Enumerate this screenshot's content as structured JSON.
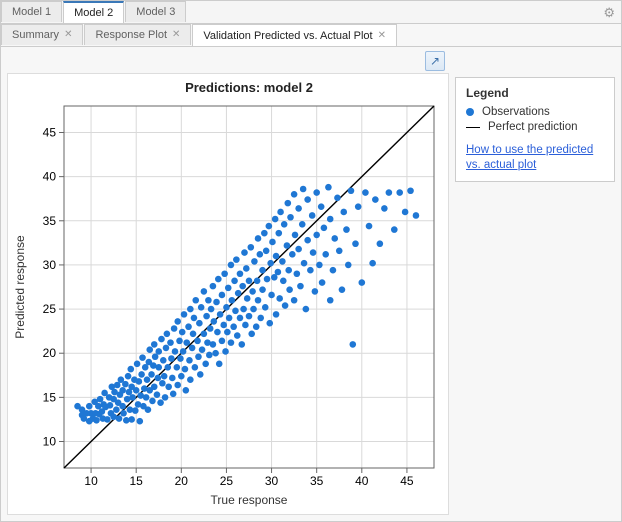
{
  "top_tabs": [
    {
      "label": "Model 1",
      "selected": false
    },
    {
      "label": "Model 2",
      "selected": true
    },
    {
      "label": "Model 3",
      "selected": false
    }
  ],
  "inner_tabs": [
    {
      "label": "Summary",
      "closable": true,
      "selected": false
    },
    {
      "label": "Response Plot",
      "closable": true,
      "selected": false
    },
    {
      "label": "Validation Predicted vs. Actual Plot",
      "closable": true,
      "selected": true
    }
  ],
  "legend": {
    "title": "Legend",
    "observations": "Observations",
    "perfect": "Perfect prediction",
    "help_link": "How to use the predicted vs. actual plot"
  },
  "chart_data": {
    "type": "scatter",
    "title": "Predictions: model 2",
    "xlabel": "True response",
    "ylabel": "Predicted response",
    "xlim": [
      7,
      48
    ],
    "ylim": [
      7,
      48
    ],
    "xticks": [
      10,
      15,
      20,
      25,
      30,
      35,
      40,
      45
    ],
    "yticks": [
      10,
      15,
      20,
      25,
      30,
      35,
      40,
      45
    ],
    "reference_line": {
      "from": [
        7,
        7
      ],
      "to": [
        48,
        48
      ]
    },
    "series": [
      {
        "name": "Observations",
        "marker": "circle",
        "color": "#1f77d4",
        "points": [
          [
            8.5,
            14.0
          ],
          [
            9.0,
            13.0
          ],
          [
            9.0,
            13.6
          ],
          [
            9.2,
            12.6
          ],
          [
            9.5,
            13.2
          ],
          [
            9.8,
            14.0
          ],
          [
            9.8,
            12.3
          ],
          [
            10.0,
            13.2
          ],
          [
            10.2,
            12.6
          ],
          [
            10.4,
            14.5
          ],
          [
            10.5,
            13.2
          ],
          [
            10.6,
            12.4
          ],
          [
            10.8,
            14.0
          ],
          [
            10.9,
            13.1
          ],
          [
            11.0,
            14.8
          ],
          [
            11.2,
            13.4
          ],
          [
            11.3,
            12.6
          ],
          [
            11.4,
            14.2
          ],
          [
            11.5,
            15.5
          ],
          [
            11.6,
            13.9
          ],
          [
            11.8,
            12.5
          ],
          [
            12.0,
            15.0
          ],
          [
            12.1,
            14.1
          ],
          [
            12.2,
            13.2
          ],
          [
            12.3,
            16.2
          ],
          [
            12.5,
            14.8
          ],
          [
            12.5,
            12.8
          ],
          [
            12.6,
            15.6
          ],
          [
            12.8,
            13.6
          ],
          [
            12.9,
            16.4
          ],
          [
            13.0,
            14.4
          ],
          [
            13.1,
            12.6
          ],
          [
            13.2,
            15.3
          ],
          [
            13.3,
            17.0
          ],
          [
            13.5,
            14.0
          ],
          [
            13.5,
            15.8
          ],
          [
            13.6,
            13.2
          ],
          [
            13.8,
            16.5
          ],
          [
            13.9,
            12.4
          ],
          [
            14.0,
            14.8
          ],
          [
            14.1,
            17.4
          ],
          [
            14.2,
            15.6
          ],
          [
            14.3,
            13.6
          ],
          [
            14.4,
            18.2
          ],
          [
            14.5,
            12.5
          ],
          [
            14.5,
            16.2
          ],
          [
            14.6,
            15.0
          ],
          [
            14.8,
            17.0
          ],
          [
            14.9,
            13.5
          ],
          [
            15.0,
            15.8
          ],
          [
            15.1,
            18.8
          ],
          [
            15.2,
            14.2
          ],
          [
            15.3,
            16.8
          ],
          [
            15.4,
            12.3
          ],
          [
            15.5,
            15.2
          ],
          [
            15.6,
            17.6
          ],
          [
            15.7,
            19.5
          ],
          [
            15.8,
            14.0
          ],
          [
            15.9,
            16.0
          ],
          [
            16.0,
            18.4
          ],
          [
            16.1,
            15.0
          ],
          [
            16.2,
            17.0
          ],
          [
            16.3,
            13.6
          ],
          [
            16.4,
            19.0
          ],
          [
            16.5,
            20.4
          ],
          [
            16.5,
            15.8
          ],
          [
            16.7,
            17.6
          ],
          [
            16.8,
            14.6
          ],
          [
            16.9,
            18.6
          ],
          [
            17.0,
            21.0
          ],
          [
            17.0,
            16.2
          ],
          [
            17.1,
            19.6
          ],
          [
            17.3,
            15.3
          ],
          [
            17.4,
            17.2
          ],
          [
            17.5,
            20.2
          ],
          [
            17.5,
            18.4
          ],
          [
            17.7,
            14.4
          ],
          [
            17.8,
            21.6
          ],
          [
            17.9,
            16.6
          ],
          [
            18.0,
            19.2
          ],
          [
            18.1,
            17.4
          ],
          [
            18.2,
            15.0
          ],
          [
            18.3,
            20.6
          ],
          [
            18.4,
            22.2
          ],
          [
            18.5,
            18.4
          ],
          [
            18.6,
            16.2
          ],
          [
            18.8,
            21.2
          ],
          [
            18.9,
            19.4
          ],
          [
            19.0,
            17.2
          ],
          [
            19.1,
            15.4
          ],
          [
            19.2,
            22.8
          ],
          [
            19.3,
            20.2
          ],
          [
            19.5,
            18.4
          ],
          [
            19.6,
            23.6
          ],
          [
            19.6,
            16.4
          ],
          [
            19.8,
            21.4
          ],
          [
            19.9,
            19.4
          ],
          [
            20.0,
            17.4
          ],
          [
            20.1,
            22.4
          ],
          [
            20.2,
            20.2
          ],
          [
            20.3,
            24.4
          ],
          [
            20.4,
            18.2
          ],
          [
            20.5,
            15.8
          ],
          [
            20.6,
            21.2
          ],
          [
            20.8,
            23.0
          ],
          [
            20.9,
            19.2
          ],
          [
            21.0,
            25.0
          ],
          [
            21.0,
            17.0
          ],
          [
            21.2,
            20.6
          ],
          [
            21.3,
            22.2
          ],
          [
            21.4,
            24.0
          ],
          [
            21.5,
            18.4
          ],
          [
            21.6,
            26.0
          ],
          [
            21.8,
            21.4
          ],
          [
            21.9,
            19.6
          ],
          [
            22.0,
            23.4
          ],
          [
            22.1,
            17.6
          ],
          [
            22.2,
            25.2
          ],
          [
            22.3,
            20.4
          ],
          [
            22.5,
            22.2
          ],
          [
            22.5,
            27.0
          ],
          [
            22.7,
            18.8
          ],
          [
            22.8,
            24.2
          ],
          [
            22.9,
            21.2
          ],
          [
            23.0,
            26.0
          ],
          [
            23.1,
            19.8
          ],
          [
            23.2,
            22.8
          ],
          [
            23.3,
            25.0
          ],
          [
            23.5,
            21.0
          ],
          [
            23.5,
            27.6
          ],
          [
            23.6,
            23.6
          ],
          [
            23.8,
            20.0
          ],
          [
            23.9,
            25.8
          ],
          [
            24.0,
            22.4
          ],
          [
            24.1,
            28.4
          ],
          [
            24.2,
            18.8
          ],
          [
            24.3,
            24.4
          ],
          [
            24.5,
            21.4
          ],
          [
            24.5,
            26.6
          ],
          [
            24.7,
            23.2
          ],
          [
            24.8,
            29.0
          ],
          [
            24.9,
            20.2
          ],
          [
            25.0,
            25.2
          ],
          [
            25.1,
            22.4
          ],
          [
            25.2,
            27.4
          ],
          [
            25.3,
            24.0
          ],
          [
            25.5,
            30.0
          ],
          [
            25.5,
            21.2
          ],
          [
            25.6,
            26.0
          ],
          [
            25.8,
            23.0
          ],
          [
            25.9,
            28.2
          ],
          [
            26.0,
            24.8
          ],
          [
            26.1,
            30.6
          ],
          [
            26.2,
            22.0
          ],
          [
            26.3,
            26.8
          ],
          [
            26.5,
            24.0
          ],
          [
            26.5,
            29.0
          ],
          [
            26.7,
            21.0
          ],
          [
            26.8,
            27.6
          ],
          [
            26.9,
            25.0
          ],
          [
            27.0,
            31.4
          ],
          [
            27.1,
            23.2
          ],
          [
            27.2,
            29.6
          ],
          [
            27.3,
            26.2
          ],
          [
            27.5,
            24.2
          ],
          [
            27.5,
            28.2
          ],
          [
            27.7,
            32.0
          ],
          [
            27.8,
            22.2
          ],
          [
            27.9,
            27.0
          ],
          [
            28.0,
            25.0
          ],
          [
            28.1,
            30.4
          ],
          [
            28.3,
            23.0
          ],
          [
            28.4,
            28.2
          ],
          [
            28.5,
            33.0
          ],
          [
            28.5,
            26.0
          ],
          [
            28.7,
            31.2
          ],
          [
            28.8,
            24.0
          ],
          [
            29.0,
            29.4
          ],
          [
            29.0,
            27.2
          ],
          [
            29.2,
            33.6
          ],
          [
            29.3,
            25.2
          ],
          [
            29.4,
            31.6
          ],
          [
            29.5,
            28.4
          ],
          [
            29.7,
            34.4
          ],
          [
            29.8,
            23.4
          ],
          [
            29.9,
            30.2
          ],
          [
            30.0,
            26.6
          ],
          [
            30.1,
            32.6
          ],
          [
            30.3,
            28.6
          ],
          [
            30.4,
            35.2
          ],
          [
            30.5,
            24.4
          ],
          [
            30.5,
            31.0
          ],
          [
            30.7,
            29.2
          ],
          [
            30.8,
            33.6
          ],
          [
            30.9,
            26.2
          ],
          [
            31.0,
            36.0
          ],
          [
            31.2,
            30.4
          ],
          [
            31.3,
            28.2
          ],
          [
            31.4,
            34.6
          ],
          [
            31.5,
            25.4
          ],
          [
            31.7,
            32.2
          ],
          [
            31.8,
            37.0
          ],
          [
            31.9,
            29.4
          ],
          [
            32.0,
            27.2
          ],
          [
            32.1,
            35.4
          ],
          [
            32.3,
            31.2
          ],
          [
            32.5,
            38.0
          ],
          [
            32.5,
            26.0
          ],
          [
            32.6,
            33.4
          ],
          [
            32.8,
            29.0
          ],
          [
            33.0,
            36.4
          ],
          [
            33.0,
            31.8
          ],
          [
            33.2,
            27.6
          ],
          [
            33.4,
            34.6
          ],
          [
            33.5,
            38.6
          ],
          [
            33.6,
            30.2
          ],
          [
            33.8,
            25.0
          ],
          [
            34.0,
            32.8
          ],
          [
            34.0,
            37.4
          ],
          [
            34.3,
            29.4
          ],
          [
            34.5,
            35.6
          ],
          [
            34.6,
            31.4
          ],
          [
            34.8,
            27.0
          ],
          [
            35.0,
            38.2
          ],
          [
            35.0,
            33.4
          ],
          [
            35.3,
            30.0
          ],
          [
            35.5,
            36.6
          ],
          [
            35.6,
            28.0
          ],
          [
            35.8,
            34.2
          ],
          [
            36.0,
            31.2
          ],
          [
            36.3,
            38.8
          ],
          [
            36.5,
            26.0
          ],
          [
            36.5,
            35.2
          ],
          [
            36.8,
            29.4
          ],
          [
            37.0,
            33.0
          ],
          [
            37.3,
            37.6
          ],
          [
            37.5,
            31.6
          ],
          [
            37.8,
            27.2
          ],
          [
            38.0,
            36.0
          ],
          [
            38.3,
            34.0
          ],
          [
            38.5,
            30.0
          ],
          [
            38.8,
            38.4
          ],
          [
            39.0,
            21.0
          ],
          [
            39.3,
            32.4
          ],
          [
            39.6,
            36.6
          ],
          [
            40.0,
            28.0
          ],
          [
            40.4,
            38.2
          ],
          [
            40.8,
            34.4
          ],
          [
            41.2,
            30.2
          ],
          [
            41.5,
            37.4
          ],
          [
            42.0,
            32.4
          ],
          [
            42.5,
            36.4
          ],
          [
            43.0,
            38.2
          ],
          [
            43.6,
            34.0
          ],
          [
            44.2,
            38.2
          ],
          [
            44.8,
            36.0
          ],
          [
            45.4,
            38.4
          ],
          [
            46.0,
            35.6
          ]
        ]
      }
    ]
  }
}
